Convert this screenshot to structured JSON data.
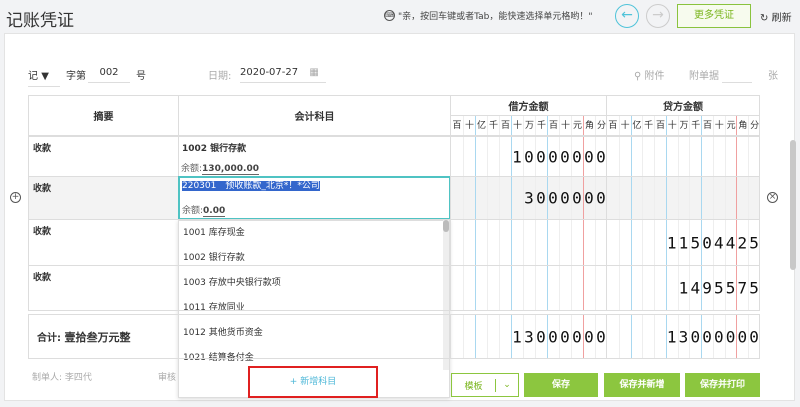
{
  "header": {
    "title": "记账凭证",
    "tip": "\"亲，按回车键或者Tab，能快速选择单元格哟！\"",
    "more_label": "更多凭证",
    "refresh_label": "刷新"
  },
  "meta": {
    "type": "记",
    "zi_label": "字第",
    "number": "002",
    "hao_label": "号",
    "date_label": "日期:",
    "date": "2020-07-27",
    "attach_label": "附件",
    "docs_label": "附单据",
    "docs_count": "",
    "zhang_label": "张"
  },
  "table": {
    "summary_header": "摘要",
    "account_header": "会计科目",
    "debit_header": "借方金额",
    "credit_header": "贷方金额",
    "digit_labels": [
      "百",
      "十",
      "亿",
      "千",
      "百",
      "十",
      "万",
      "千",
      "百",
      "十",
      "元",
      "角",
      "分"
    ],
    "rows": [
      {
        "summary": "收款",
        "account": "1002 银行存款",
        "balance_label": "余额:",
        "balance": "130,000.00",
        "debit": "10000000",
        "credit": ""
      },
      {
        "summary": "收款",
        "account": "220301　预收账款_北京*！*公司",
        "balance_label": "余额:",
        "balance": "0.00",
        "debit": "3000000",
        "credit": ""
      },
      {
        "summary": "收款",
        "account": "",
        "debit": "",
        "credit": "11504425"
      },
      {
        "summary": "收款",
        "account": "",
        "debit": "",
        "credit": "1495575"
      }
    ],
    "total_label": "合计:",
    "total_words": "壹拾叁万元整",
    "total_debit": "13000000",
    "total_credit": "13000000"
  },
  "dropdown": {
    "items": [
      "1001 库存现金",
      "1002 银行存款",
      "1003 存放中央银行款项",
      "1011 存放同业",
      "1012 其他货币资金",
      "1021 结算备付金"
    ],
    "add_label": "+ 新增科目"
  },
  "footer": {
    "maker_label": "制单人:",
    "maker": "李四代",
    "reviewer_label": "审核",
    "template_label": "模板",
    "save": "保存",
    "save_new": "保存并新增",
    "save_print": "保存并打印"
  },
  "colors": {
    "accent": "#8cc63f",
    "selection": "#3366cc",
    "highlight_border": "#4fc3c3"
  }
}
